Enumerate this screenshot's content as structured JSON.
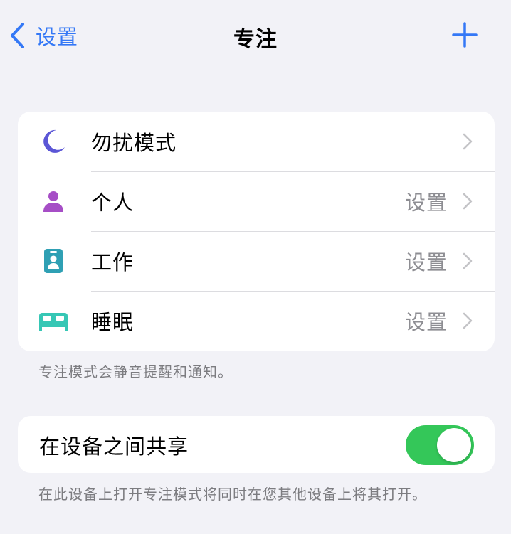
{
  "nav": {
    "back_label": "设置",
    "title": "专注",
    "add_icon": "plus-icon"
  },
  "modes": [
    {
      "label": "勿扰模式",
      "detail": "",
      "icon": "moon-icon",
      "color": "#5b56d6"
    },
    {
      "label": "个人",
      "detail": "设置",
      "icon": "person-icon",
      "color": "#a64ec6"
    },
    {
      "label": "工作",
      "detail": "设置",
      "icon": "id-badge-icon",
      "color": "#2fa0b4"
    },
    {
      "label": "睡眠",
      "detail": "设置",
      "icon": "bed-icon",
      "color": "#36c7b5"
    }
  ],
  "modes_footnote": "专注模式会静音提醒和通知。",
  "share": {
    "label": "在设备之间共享",
    "enabled": true,
    "toggle_color": "#34c759",
    "footnote": "在此设备上打开专注模式将同时在您其他设备上将其打开。"
  },
  "colors": {
    "accent": "#3478f6",
    "background": "#f2f2f7"
  }
}
